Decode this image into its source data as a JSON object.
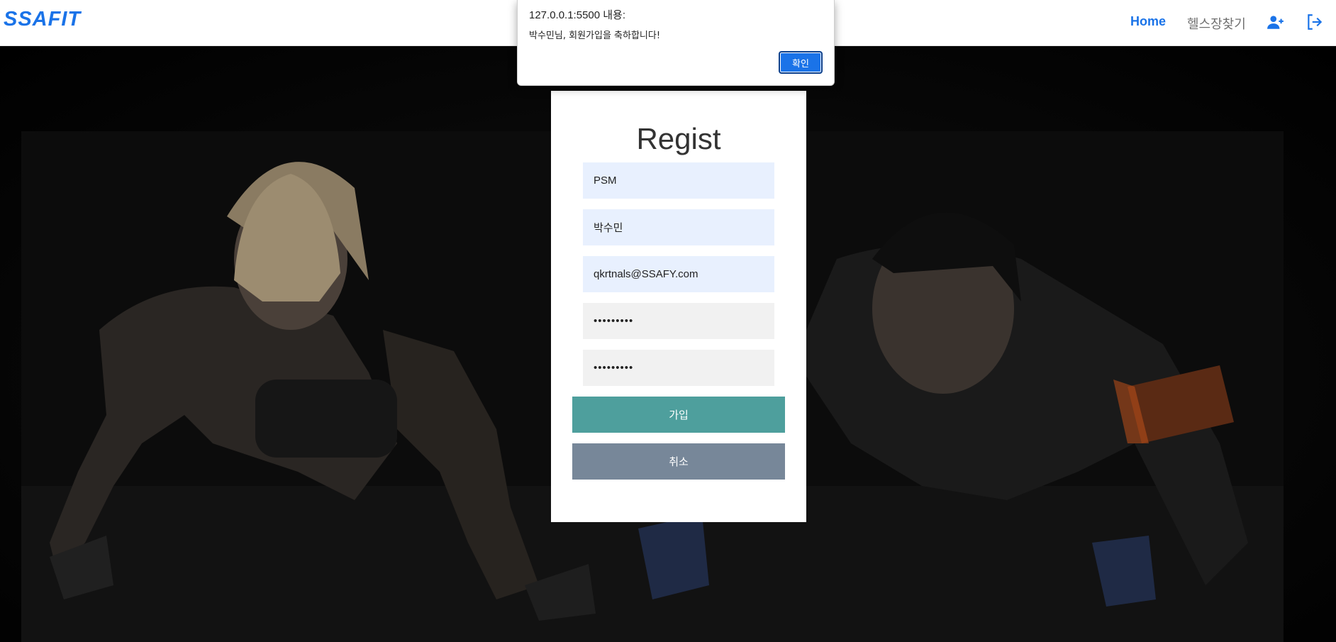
{
  "navbar": {
    "brand": "SSAFIT",
    "home": "Home",
    "find_gym": "헬스장찾기",
    "signup_icon": "user-plus-icon",
    "logout_icon": "logout-icon",
    "accent_color": "#1a73e8"
  },
  "hero": {
    "background_icon": "workout-photo"
  },
  "register": {
    "title": "Regist",
    "id_value": "PSM",
    "name_value": "박수민",
    "email_value": "qkrtnals@SSAFY.com",
    "password_value": "•••••••••",
    "password_confirm_value": "•••••••••",
    "join_label": "가입",
    "cancel_label": "취소",
    "join_color": "#4e9f9d",
    "cancel_color": "#778799"
  },
  "alert": {
    "origin": "127.0.0.1:5500 내용:",
    "message": "박수민님, 회원가입을 축하합니다!",
    "ok_label": "확인"
  }
}
